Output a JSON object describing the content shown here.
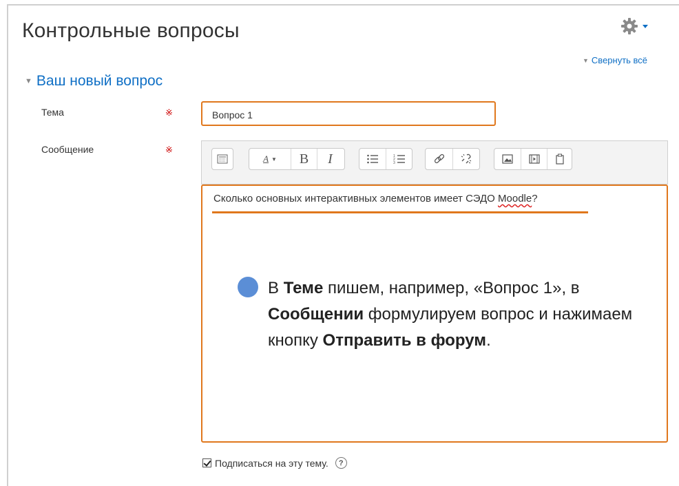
{
  "header": {
    "title": "Контрольные вопросы",
    "collapse_all": "Свернуть всё",
    "settings_icon": "gear-icon"
  },
  "section": {
    "title": "Ваш новый вопрос"
  },
  "form": {
    "subject_label": "Тема",
    "subject_value": "Вопрос 1",
    "message_label": "Сообщение",
    "required_mark": "※",
    "editor": {
      "text_before": "Сколько основных интерактивных элементов имеет СЭДО ",
      "text_misspelled": "Moodle",
      "text_after": "?"
    },
    "toolbar": {
      "icons": [
        "toolbar-toggle-icon",
        "font-style-icon",
        "bold-icon",
        "italic-icon",
        "unordered-list-icon",
        "ordered-list-icon",
        "link-icon",
        "unlink-icon",
        "image-icon",
        "media-icon",
        "manage-files-icon"
      ],
      "bold": "B",
      "italic": "I",
      "font_style": "A"
    },
    "subscribe_label": "Подписаться на эту тему.",
    "subscribe_checked": true,
    "help_mark": "?"
  },
  "callout": {
    "p1": "В ",
    "b1": "Теме",
    "p2": " пишем, например, «Вопрос 1», в ",
    "b2": "Сообщении",
    "p3": " формулируем вопрос и нажимаем кнопку ",
    "b3": "Отправить в форум",
    "p4": "."
  },
  "colors": {
    "accent_link": "#0f6fc5",
    "highlight": "#e0771c",
    "required": "#cc0000",
    "bullet": "#5b8ed6"
  }
}
